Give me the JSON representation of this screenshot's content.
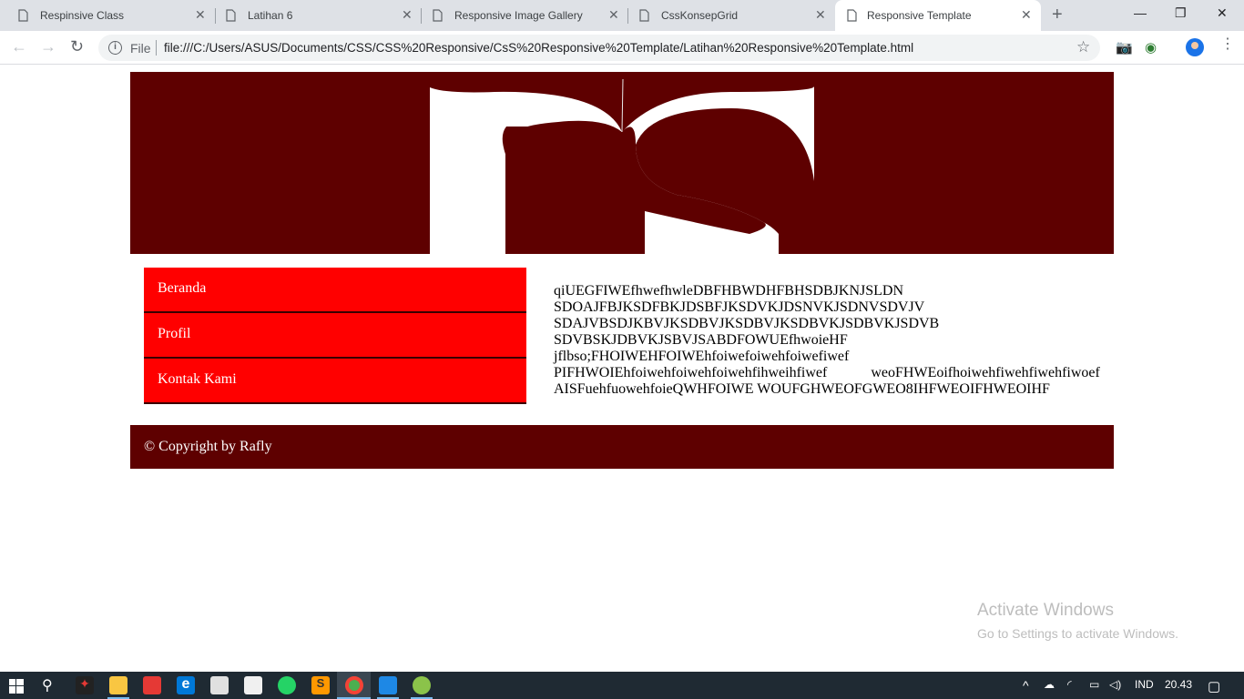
{
  "browser": {
    "tabs": [
      {
        "title": "Respinsive Class",
        "active": false
      },
      {
        "title": "Latihan 6",
        "active": false
      },
      {
        "title": "Responsive Image Gallery",
        "active": false
      },
      {
        "title": "CssKonsepGrid",
        "active": false
      },
      {
        "title": "Responsive Template",
        "active": true
      }
    ],
    "scheme_label": "File",
    "url": "file:///C:/Users/ASUS/Documents/CSS/CSS%20Responsive/CsS%20Responsive%20Template/Latihan%20Responsive%20Template.html"
  },
  "page": {
    "menu": [
      "Beranda",
      "Profil",
      "Kontak Kami"
    ],
    "content_lines": [
      "qiUEGFIWEfhwefhwleDBFHBWDHFBHSDBJKNJSLDN",
      "SDOAJFBJKSDFBKJDSBFJKSDVKJDSNVKJSDNVSDVJV",
      "SDAJVBSDJKBVJKSDBVJKSDBVJKSDBVKJSDBVKJSDVB",
      "SDVBSKJDBVKJSBVJSABDFOWUEfhwoieHF",
      "jflbso;FHOIWEHFOIWEhfoiwefoiwehfoiwefiwef",
      "PIFHWOIEhfoiwehfoiwehfoiwehfihweihfiwef            weoFHWEoifhoiwehfiwehfiwehfiwoef",
      "AISFuehfuowehfoieQWHFOIWE WOUFGHWEOFGWEO8IHFWEOIFHWEOIHF"
    ],
    "footer": "© Copyright by Rafly",
    "colors": {
      "banner": "#5e0000",
      "menu": "#ff0000",
      "footer": "#5e0000"
    }
  },
  "watermark": {
    "line1": "Activate Windows",
    "line2": "Go to Settings to activate Windows."
  },
  "taskbar": {
    "language": "IND",
    "time": "20.43"
  }
}
